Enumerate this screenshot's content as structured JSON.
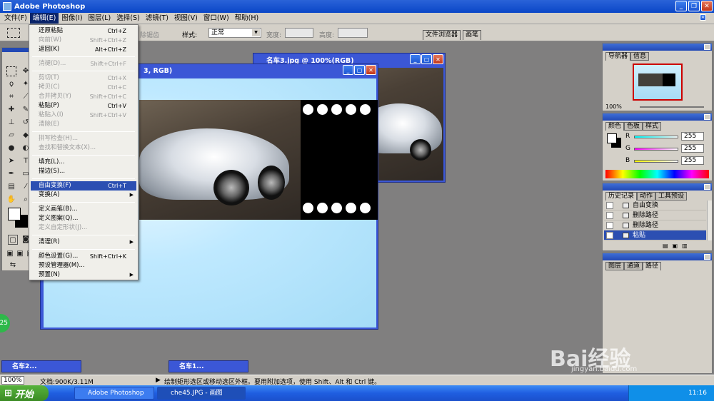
{
  "app": {
    "title": "Adobe Photoshop"
  },
  "menubar": [
    "文件(F)",
    "编辑(E)",
    "图像(I)",
    "图层(L)",
    "选择(S)",
    "滤镜(T)",
    "视图(V)",
    "窗口(W)",
    "帮助(H)"
  ],
  "options": {
    "feather": "除锯齿",
    "style_label": "样式:",
    "style_value": "正常",
    "width_label": "宽度:",
    "height_label": "高度:",
    "tab_browser": "文件浏览器",
    "tab_brush": "画笔"
  },
  "edit_menu": [
    {
      "label": "还原粘贴",
      "shortcut": "Ctrl+Z",
      "disabled": false
    },
    {
      "label": "向前(W)",
      "shortcut": "Shift+Ctrl+Z",
      "disabled": true
    },
    {
      "label": "返回(K)",
      "shortcut": "Alt+Ctrl+Z",
      "disabled": false
    },
    {
      "label": "消褪(D)...",
      "shortcut": "Shift+Ctrl+F",
      "disabled": true
    },
    {
      "label": "剪切(T)",
      "shortcut": "Ctrl+X",
      "disabled": true
    },
    {
      "label": "拷贝(C)",
      "shortcut": "Ctrl+C",
      "disabled": true
    },
    {
      "label": "合并拷贝(Y)",
      "shortcut": "Shift+Ctrl+C",
      "disabled": true
    },
    {
      "label": "粘贴(P)",
      "shortcut": "Ctrl+V",
      "disabled": false
    },
    {
      "label": "粘贴入(I)",
      "shortcut": "Shift+Ctrl+V",
      "disabled": true
    },
    {
      "label": "清除(E)",
      "shortcut": "",
      "disabled": true
    },
    {
      "label": "拼写检查(H)...",
      "shortcut": "",
      "disabled": true
    },
    {
      "label": "查找和替换文本(X)...",
      "shortcut": "",
      "disabled": true
    },
    {
      "label": "填充(L)...",
      "shortcut": "",
      "disabled": false
    },
    {
      "label": "描边(S)...",
      "shortcut": "",
      "disabled": false
    },
    {
      "label": "自由变换(F)",
      "shortcut": "Ctrl+T",
      "disabled": false,
      "highlighted": true
    },
    {
      "label": "变换(A)",
      "shortcut": "",
      "disabled": false,
      "submenu": true
    },
    {
      "label": "定义画笔(B)...",
      "shortcut": "",
      "disabled": false
    },
    {
      "label": "定义图案(Q)...",
      "shortcut": "",
      "disabled": false
    },
    {
      "label": "定义自定形状(J)...",
      "shortcut": "",
      "disabled": true
    },
    {
      "label": "清理(R)",
      "shortcut": "",
      "disabled": false,
      "submenu": true
    },
    {
      "label": "颜色设置(G)...",
      "shortcut": "Shift+Ctrl+K",
      "disabled": false
    },
    {
      "label": "预设管理器(M)...",
      "shortcut": "",
      "disabled": false
    },
    {
      "label": "预置(N)",
      "shortcut": "",
      "disabled": false,
      "submenu": true
    }
  ],
  "doc_main": {
    "title": "3, RGB)"
  },
  "doc_back": {
    "title": "名车3.jpg @ 100%(RGB)"
  },
  "navigator": {
    "tab1": "导航器",
    "tab2": "信息",
    "zoom": "100%"
  },
  "color_panel": {
    "tab1": "颜色",
    "tab2": "色板",
    "tab3": "样式",
    "r_label": "R",
    "g_label": "G",
    "b_label": "B",
    "r": "255",
    "g": "255",
    "b": "255"
  },
  "history": {
    "tab1": "历史记录",
    "tab2": "动作",
    "tab3": "工具预设",
    "items": [
      "自由变换",
      "删除路径",
      "删除路径",
      "粘贴"
    ]
  },
  "layers": {
    "tab1": "图层",
    "tab2": "通道",
    "tab3": "路径"
  },
  "minimized": [
    "名车2...",
    "名车1..."
  ],
  "status": {
    "zoom": "100%",
    "doc": "文档:900K/3.11M",
    "hint": "绘制矩形选区或移动选区外框。要用附加选项，使用 Shift、Alt 和 Ctrl 键。"
  },
  "taskbar": {
    "start": "开始",
    "task1": "Adobe Photoshop",
    "task2": "che45.JPG - 画图",
    "clock": "11:16"
  },
  "badge": "25",
  "watermark": {
    "brand": "Bai经验",
    "url": "jingyan.baidu.com"
  }
}
